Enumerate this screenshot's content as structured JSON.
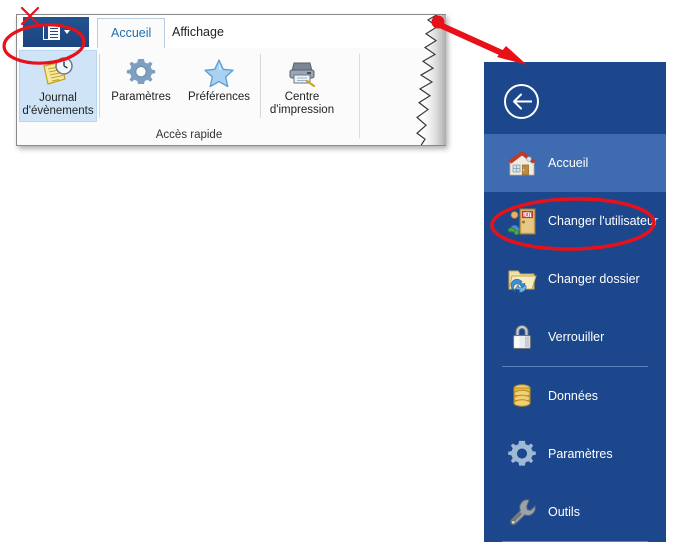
{
  "window": {
    "tabs": [
      {
        "label": "Accueil",
        "active": true
      },
      {
        "label": "Affichage",
        "active": false
      }
    ],
    "app_button": {
      "name": "application-menu-button",
      "icon": "panel-book-icon",
      "caret": "dropdown-caret"
    },
    "group": {
      "title": "Accès rapide",
      "buttons": [
        {
          "label": "Journal\nd'évènements",
          "icon": "event-log-icon",
          "selected": true
        },
        {
          "label": "Paramètres",
          "icon": "gear-icon",
          "selected": false
        },
        {
          "label": "Préférences",
          "icon": "star-icon",
          "selected": false
        },
        {
          "label": "Centre\nd'impression",
          "icon": "printer-icon",
          "selected": false
        }
      ]
    }
  },
  "backstage": {
    "back_button": "back-arrow",
    "items": [
      {
        "label": "Accueil",
        "icon": "home-icon",
        "highlight": true,
        "separator_after": false
      },
      {
        "label": "Changer l'utilisateur",
        "icon": "switch-user-icon",
        "highlight": false,
        "separator_after": false
      },
      {
        "label": "Changer dossier",
        "icon": "change-folder-icon",
        "highlight": false,
        "separator_after": false
      },
      {
        "label": "Verrouiller",
        "icon": "lock-icon",
        "highlight": false,
        "separator_after": true
      },
      {
        "label": "Données",
        "icon": "database-icon",
        "highlight": false,
        "separator_after": false
      },
      {
        "label": "Paramètres",
        "icon": "gear-icon",
        "highlight": false,
        "separator_after": false
      },
      {
        "label": "Outils",
        "icon": "wrench-icon",
        "highlight": false,
        "separator_after": true
      }
    ]
  },
  "annotations": {
    "accent_color": "#e8111a",
    "marks": [
      {
        "type": "x-mark",
        "name": "red-x-mark"
      },
      {
        "type": "ellipse",
        "name": "highlight-ellipse-app-button"
      },
      {
        "type": "arrow",
        "name": "red-pointer-arrow"
      },
      {
        "type": "ellipse",
        "name": "highlight-ellipse-changer-utilisateur"
      }
    ]
  },
  "colors": {
    "panel_dark_blue": "#1d478c",
    "panel_light_blue": "#3f6cb0",
    "app_button_blue": "#1e4c8a",
    "ribbon_selected": "#cfe4f7",
    "tab_active_text": "#1f6fb5"
  }
}
